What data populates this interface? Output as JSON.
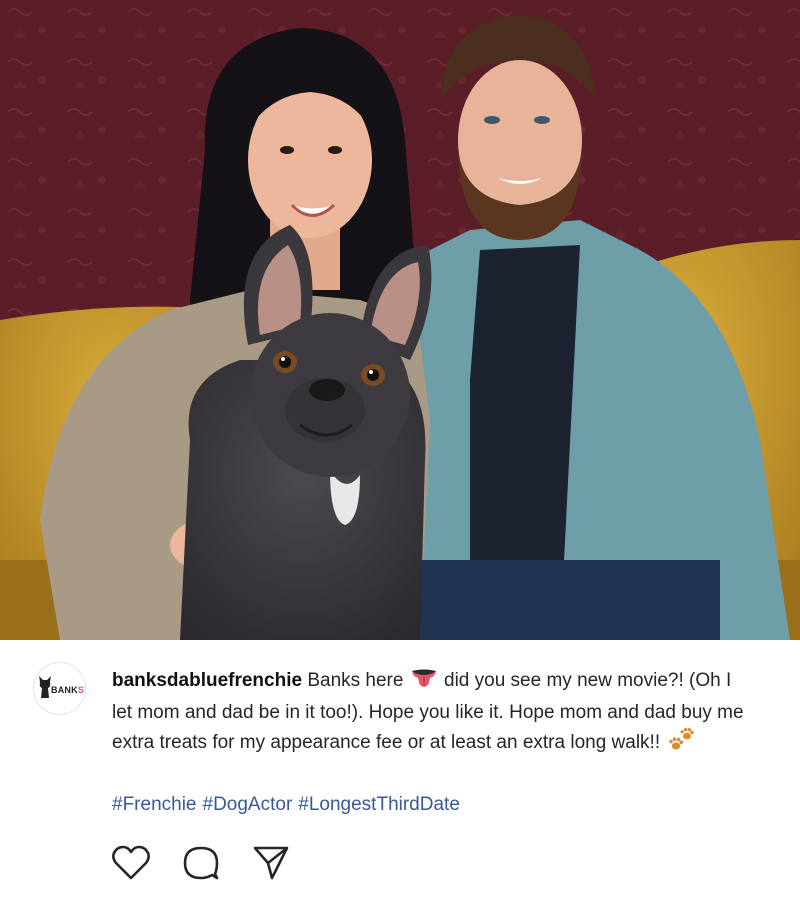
{
  "photo": {
    "alt_icon": "post-photo"
  },
  "post": {
    "avatar_brand_main": "BANK",
    "avatar_brand_accent": "S",
    "username": "banksdabluefrenchie",
    "caption_part1": " Banks here ",
    "caption_part2": " did you see my new movie?! (Oh I let mom and dad be in it too!). Hope you like it. Hope mom and dad buy me extra treats for my appearance fee or at least an extra long walk!! ",
    "emoji_1": "tongue-emoji",
    "emoji_2": "paw-prints-emoji",
    "hashtags": [
      "#Frenchie",
      "#DogActor",
      "#LongestThirdDate"
    ]
  },
  "actions": {
    "like_icon": "heart-icon",
    "comment_icon": "comment-icon",
    "share_icon": "send-icon"
  },
  "colors": {
    "hashtag": "#385898",
    "text": "#262626",
    "wall": "#5a1c27",
    "sofa": "#c99a2e"
  }
}
